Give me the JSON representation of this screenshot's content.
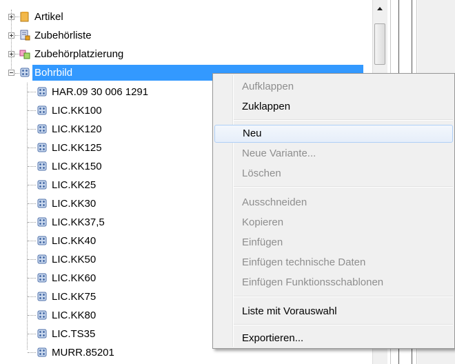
{
  "tree": {
    "root_items": [
      {
        "label": "Artikel",
        "icon": "folder-icon"
      },
      {
        "label": "Zubehörliste",
        "icon": "list-icon"
      },
      {
        "label": "Zubehörplatzierung",
        "icon": "placement-icon"
      },
      {
        "label": "Bohrbild",
        "icon": "drill-pattern-icon"
      }
    ],
    "children": [
      "HAR.09 30 006 1291",
      "LIC.KK100",
      "LIC.KK120",
      "LIC.KK125",
      "LIC.KK150",
      "LIC.KK25",
      "LIC.KK30",
      "LIC.KK37,5",
      "LIC.KK40",
      "LIC.KK50",
      "LIC.KK60",
      "LIC.KK75",
      "LIC.KK80",
      "LIC.TS35",
      "MURR.85201"
    ],
    "selected": "Bohrbild"
  },
  "context_menu": {
    "aufklappen": "Aufklappen",
    "zuklappen": "Zuklappen",
    "neu": "Neu",
    "neue_variante": "Neue Variante...",
    "loeschen": "Löschen",
    "ausschneiden": "Ausschneiden",
    "kopieren": "Kopieren",
    "einfuegen": "Einfügen",
    "einfuegen_technische_daten": "Einfügen technische Daten",
    "einfuegen_funktionsschablonen": "Einfügen Funktionsschablonen",
    "liste_mit_vorauswahl": "Liste mit Vorauswahl",
    "exportieren": "Exportieren..."
  },
  "colors": {
    "selection": "#3399ff",
    "menu_background": "#f0f0f0",
    "menu_hot": "#e6eefa",
    "disabled_text": "#8e8e8e"
  }
}
